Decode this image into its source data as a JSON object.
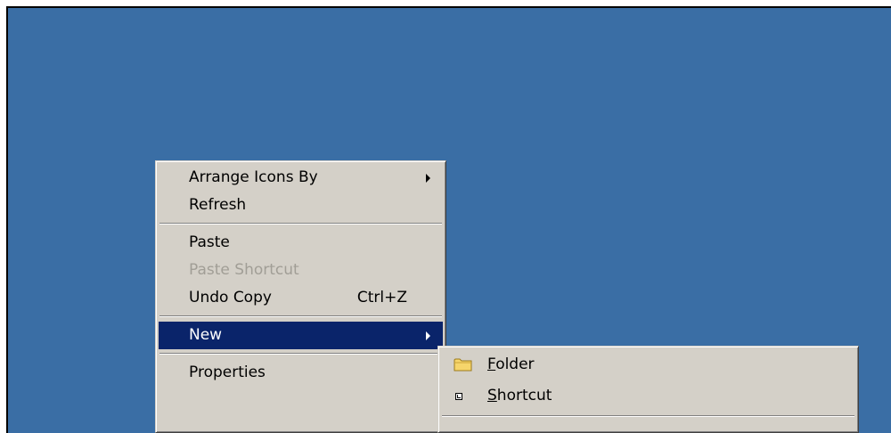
{
  "context_menu": {
    "items": [
      {
        "label": "Arrange Icons By",
        "has_submenu": true
      },
      {
        "label": "Refresh"
      },
      {
        "label": "Paste"
      },
      {
        "label": "Paste Shortcut",
        "disabled": true
      },
      {
        "label": "Undo Copy",
        "shortcut": "Ctrl+Z"
      },
      {
        "label": "New",
        "has_submenu": true,
        "highlighted": true
      },
      {
        "label": "Properties"
      }
    ]
  },
  "new_submenu": {
    "items": [
      {
        "mnemonic": "F",
        "rest": "older",
        "icon": "folder-icon"
      },
      {
        "mnemonic": "S",
        "rest": "hortcut",
        "icon": "shortcut-icon"
      }
    ]
  },
  "colors": {
    "desktop": "#3a6ea5",
    "menu_face": "#d4d0c8",
    "highlight": "#0a246a",
    "disabled_text": "#a19e96"
  }
}
